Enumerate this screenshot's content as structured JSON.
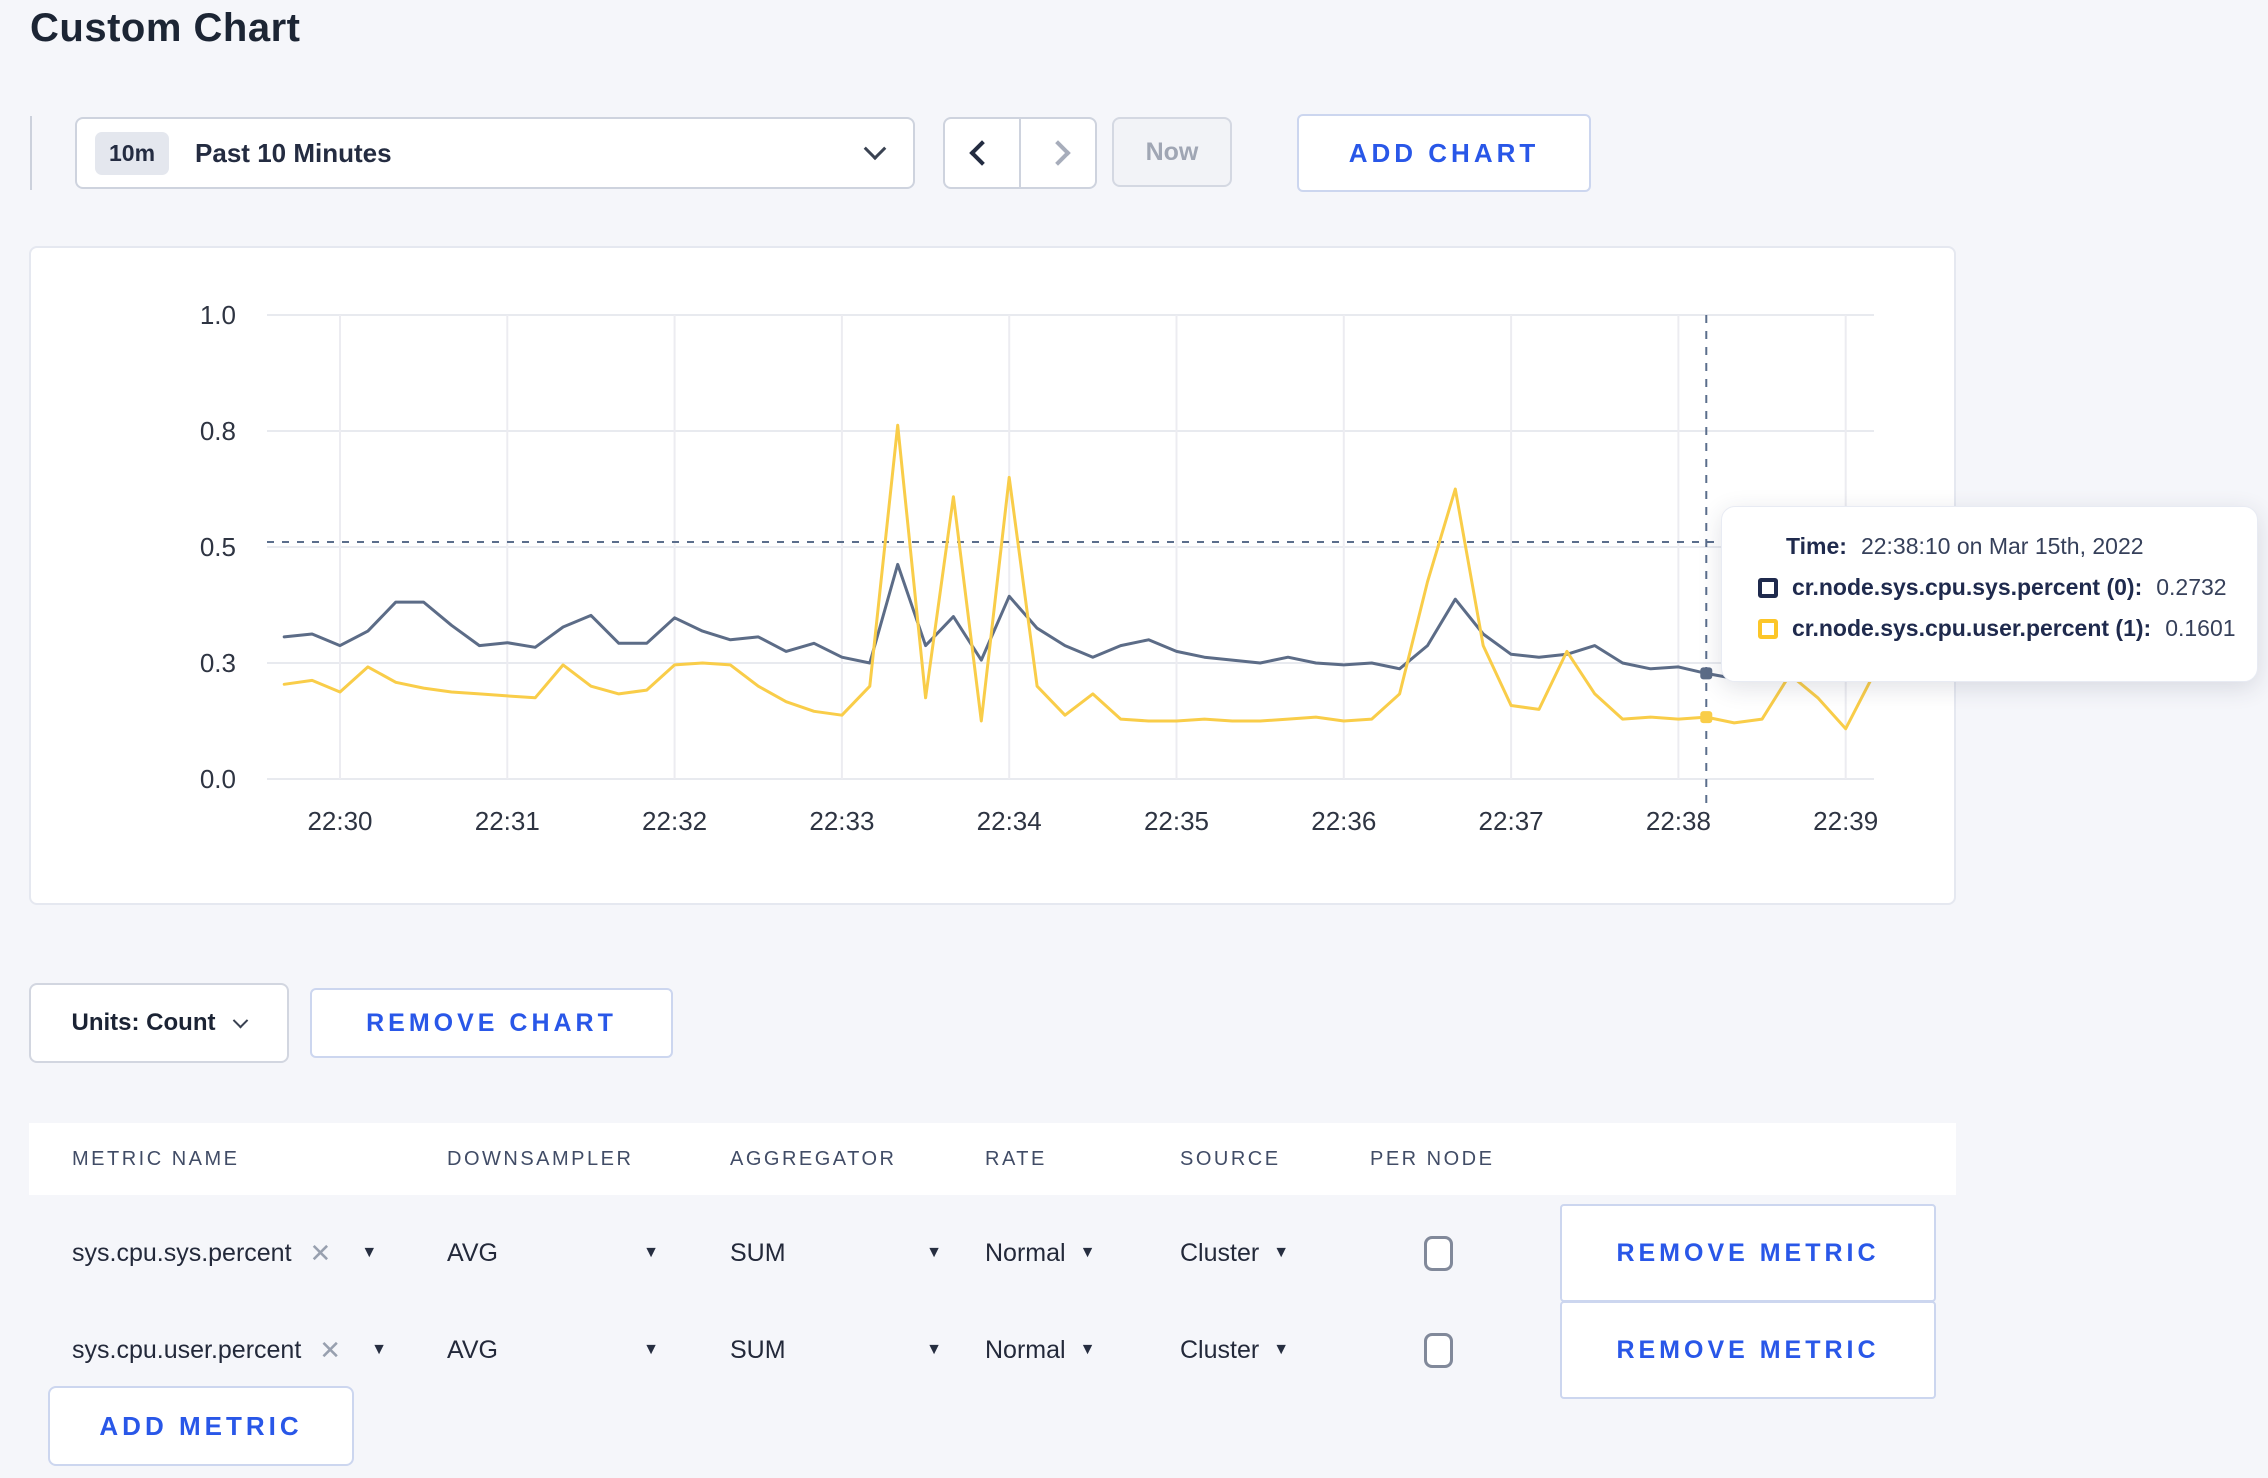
{
  "page": {
    "title": "Custom Chart"
  },
  "icons": {
    "caret_down": "▼",
    "close": "✕"
  },
  "toolbar": {
    "time_range": {
      "badge": "10m",
      "label": "Past 10 Minutes"
    },
    "now_label": "Now",
    "add_chart_label": "ADD CHART"
  },
  "chart_data": {
    "type": "line",
    "title": "",
    "xlabel": "",
    "ylabel": "",
    "ylim": [
      0.0,
      1.0
    ],
    "grid": true,
    "legend_position": "tooltip",
    "x_ticks": [
      "22:30",
      "22:31",
      "22:32",
      "22:33",
      "22:34",
      "22:35",
      "22:36",
      "22:37",
      "22:38",
      "22:39"
    ],
    "y_ticks": [
      1.0,
      0.8,
      0.5,
      0.3,
      0.0
    ],
    "points_start_second": -20,
    "points_step_seconds": 10,
    "series": [
      {
        "name": "cr.node.sys.cpu.sys.percent (0)",
        "color": "#5c6c87",
        "values": [
          0.345,
          0.35,
          0.33,
          0.355,
          0.405,
          0.405,
          0.365,
          0.33,
          0.335,
          0.327,
          0.362,
          0.382,
          0.334,
          0.334,
          0.378,
          0.355,
          0.34,
          0.345,
          0.32,
          0.334,
          0.31,
          0.3,
          0.47,
          0.33,
          0.38,
          0.305,
          0.415,
          0.36,
          0.33,
          0.31,
          0.33,
          0.34,
          0.32,
          0.31,
          0.305,
          0.3,
          0.31,
          0.3,
          0.295,
          0.3,
          0.285,
          0.33,
          0.41,
          0.35,
          0.315,
          0.31,
          0.315,
          0.33,
          0.3,
          0.285,
          0.29,
          0.2732,
          0.26,
          0.3,
          0.325,
          0.3,
          0.295,
          0.305
        ]
      },
      {
        "name": "cr.node.sys.cpu.user.percent (1)",
        "color": "#f9cd49",
        "values": [
          0.245,
          0.255,
          0.225,
          0.29,
          0.25,
          0.235,
          0.225,
          0.22,
          0.215,
          0.21,
          0.295,
          0.24,
          0.22,
          0.23,
          0.295,
          0.3,
          0.295,
          0.24,
          0.2,
          0.175,
          0.165,
          0.24,
          0.81,
          0.21,
          0.63,
          0.15,
          0.68,
          0.24,
          0.165,
          0.22,
          0.155,
          0.15,
          0.15,
          0.155,
          0.15,
          0.15,
          0.155,
          0.16,
          0.15,
          0.155,
          0.22,
          0.44,
          0.65,
          0.33,
          0.19,
          0.18,
          0.32,
          0.22,
          0.155,
          0.16,
          0.155,
          0.1601,
          0.145,
          0.155,
          0.27,
          0.21,
          0.13,
          0.27
        ]
      }
    ],
    "crosshair": {
      "time": "22:38:10",
      "x_seconds": 490,
      "guide_value": 0.513,
      "marker_values": [
        0.2732,
        0.1601
      ]
    }
  },
  "tooltip": {
    "time_label": "Time:",
    "time_value": "22:38:10 on Mar 15th, 2022",
    "series": [
      {
        "label": "cr.node.sys.cpu.sys.percent (0):",
        "value": "0.2732",
        "color": "#1f2a4d"
      },
      {
        "label": "cr.node.sys.cpu.user.percent (1):",
        "value": "0.1601",
        "color": "#fcc629"
      }
    ]
  },
  "chart_footer": {
    "units_label": "Units: Count",
    "remove_chart_label": "REMOVE CHART"
  },
  "metrics_table": {
    "columns": [
      "METRIC NAME",
      "DOWNSAMPLER",
      "AGGREGATOR",
      "RATE",
      "SOURCE",
      "PER NODE"
    ],
    "rows": [
      {
        "metric": "sys.cpu.sys.percent",
        "downsampler": "AVG",
        "aggregator": "SUM",
        "rate": "Normal",
        "source": "Cluster",
        "per_node_checked": false,
        "remove_label": "REMOVE METRIC"
      },
      {
        "metric": "sys.cpu.user.percent",
        "downsampler": "AVG",
        "aggregator": "SUM",
        "rate": "Normal",
        "source": "Cluster",
        "per_node_checked": false,
        "remove_label": "REMOVE METRIC"
      }
    ],
    "add_metric_label": "ADD METRIC"
  }
}
